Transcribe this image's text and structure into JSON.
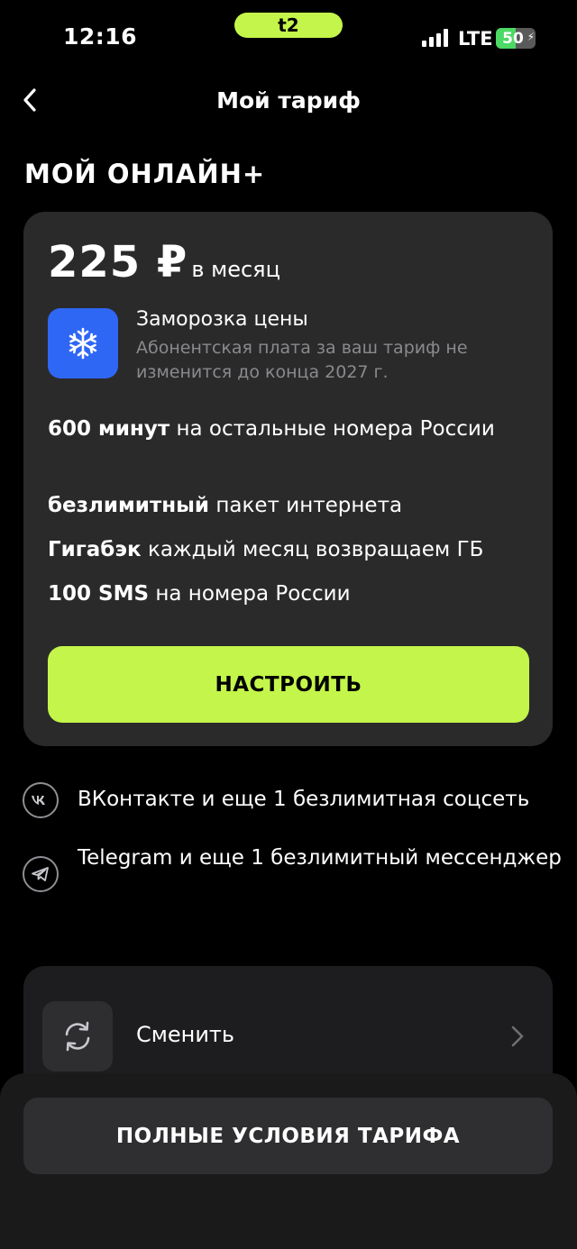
{
  "status_bar": {
    "time": "12:16",
    "carrier_logo": "t2",
    "network": "LTE",
    "battery": "50",
    "battery_level_percent": 50
  },
  "header": {
    "title": "Мой тариф"
  },
  "plan": {
    "name": "МОЙ ОНЛАЙН+",
    "price": "225 ₽",
    "period": "в месяц",
    "freeze": {
      "title": "Заморозка цены",
      "description": "Абонентская плата за ваш тариф не изменится до конца 2027 г."
    },
    "features": [
      {
        "bold": "600 минут",
        "text": "на остальные номера России"
      },
      {
        "bold": "безлимитный",
        "text": "пакет интернета"
      },
      {
        "bold": "Гигабэк",
        "text": "каждый месяц возвращаем ГБ"
      },
      {
        "bold": "100 SMS",
        "text": "на номера России"
      }
    ],
    "setup_label": "НАСТРОИТЬ"
  },
  "perks": [
    {
      "icon": "vk-icon",
      "text": "ВКонтакте и еще 1 безлимитная соцсеть"
    },
    {
      "icon": "telegram-icon",
      "text": "Telegram и еще 1 безлимитный мессенджер"
    }
  ],
  "change": {
    "label": "Сменить"
  },
  "terms_label": "ПОЛНЫЕ УСЛОВИЯ ТАРИФА",
  "colors": {
    "accent": "#c4f54a",
    "freeze_blue": "#2f67f5",
    "card": "#2a2a2b"
  }
}
